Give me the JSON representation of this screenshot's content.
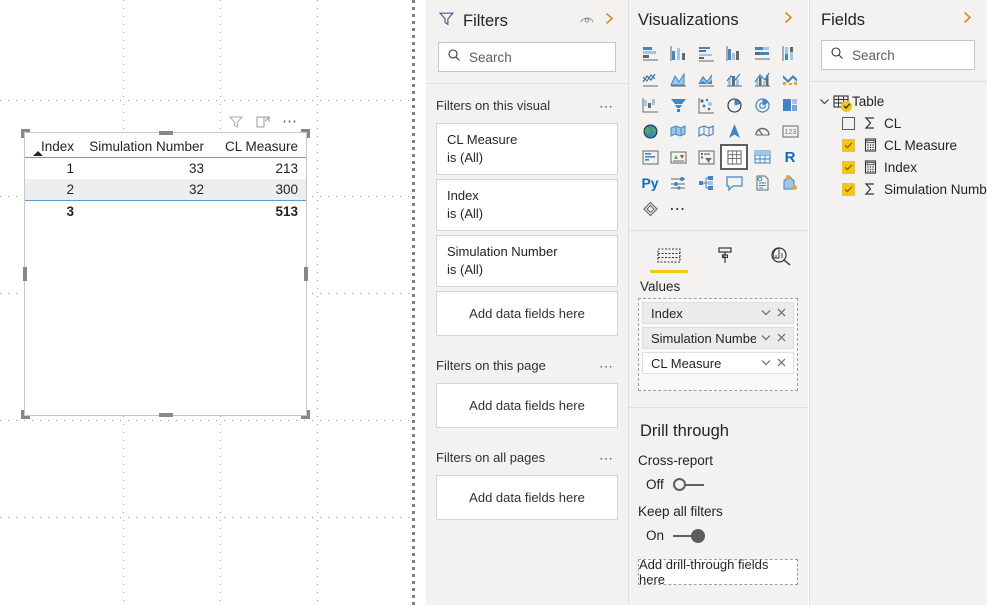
{
  "canvas": {
    "visual_header": {
      "filter_icon": "filter-funnel-icon",
      "focus_icon": "focus-mode-icon",
      "more_label": "⋯"
    },
    "table_visual": {
      "columns": [
        "Index",
        "Simulation Number",
        "CL Measure"
      ],
      "sort_column": "Index",
      "sort_direction": "ascending",
      "rows": [
        {
          "index": "1",
          "simulation_number": "33",
          "cl_measure": "213"
        },
        {
          "index": "2",
          "simulation_number": "32",
          "cl_measure": "300"
        }
      ],
      "total": {
        "index": "3",
        "simulation_number": "",
        "cl_measure": "513"
      }
    }
  },
  "filters": {
    "title": "Filters",
    "hide_icon": "eye-hide-icon",
    "expand_icon": "chevron-right-icon",
    "search": {
      "placeholder": "Search",
      "icon": "search-icon"
    },
    "groups": [
      {
        "label": "Filters on this visual",
        "menu": "⋯",
        "cards": [
          {
            "name": "CL Measure",
            "value": "is (All)"
          },
          {
            "name": "Index",
            "value": "is (All)"
          },
          {
            "name": "Simulation Number",
            "value": "is (All)"
          }
        ],
        "dropzone": "Add data fields here"
      },
      {
        "label": "Filters on this page",
        "menu": "⋯",
        "cards": [],
        "dropzone": "Add data fields here"
      },
      {
        "label": "Filters on all pages",
        "menu": "⋯",
        "cards": [],
        "dropzone": "Add data fields here"
      }
    ]
  },
  "visualizations": {
    "title": "Visualizations",
    "expand_icon": "chevron-right-icon",
    "gallery": [
      "stacked-bar-chart-icon",
      "stacked-column-chart-icon",
      "clustered-bar-chart-icon",
      "clustered-column-chart-icon",
      "hundred-percent-stacked-bar-chart-icon",
      "hundred-percent-stacked-column-chart-icon",
      "line-chart-icon",
      "area-chart-icon",
      "stacked-area-chart-icon",
      "line-stacked-column-chart-icon",
      "line-clustered-column-chart-icon",
      "ribbon-chart-icon",
      "waterfall-chart-icon",
      "funnel-chart-icon",
      "scatter-chart-icon",
      "pie-chart-icon",
      "donut-chart-icon",
      "treemap-icon",
      "map-icon",
      "filled-map-icon",
      "shape-map-icon",
      "arcgis-map-icon",
      "gauge-icon",
      "card-icon",
      "multi-row-card-icon",
      "kpi-icon",
      "slicer-icon",
      "table-icon",
      "matrix-icon",
      "r-script-visual-icon",
      "python-visual-icon",
      "key-influencers-icon",
      "decomposition-tree-icon",
      "qna-icon",
      "smart-narrative-icon",
      "paginated-report-icon",
      "power-apps-visual-icon"
    ],
    "selected_visual": "table-icon",
    "more_visuals_label": "⋯",
    "well_tabs": [
      {
        "name": "fields-tab",
        "icon": "fields-table-icon",
        "active": true
      },
      {
        "name": "format-tab",
        "icon": "paint-roller-icon",
        "active": false
      },
      {
        "name": "analytics-tab",
        "icon": "magnifier-analytics-icon",
        "active": false
      }
    ],
    "well_label": "Values",
    "well_chips": [
      "Index",
      "Simulation Number",
      "CL Measure"
    ],
    "chip_dropdown_icon": "chevron-down-icon",
    "chip_remove_icon": "close-x-icon",
    "drill_through": {
      "title": "Drill through",
      "cross_report_label": "Cross-report",
      "cross_report_state": "Off",
      "keep_all_filters_label": "Keep all filters",
      "keep_all_filters_state": "On",
      "dropzone": "Add drill-through fields here"
    }
  },
  "fields": {
    "title": "Fields",
    "expand_icon": "chevron-right-icon",
    "search": {
      "placeholder": "Search",
      "icon": "search-icon"
    },
    "table": {
      "label": "Table",
      "expanded": true,
      "chevron": "chevron-down-icon"
    },
    "items": [
      {
        "label": "CL",
        "checked": false,
        "icon": "sigma-icon"
      },
      {
        "label": "CL Measure",
        "checked": true,
        "icon": "calculator-measure-icon"
      },
      {
        "label": "Index",
        "checked": true,
        "icon": "calculator-measure-icon"
      },
      {
        "label": "Simulation Numb...",
        "checked": true,
        "icon": "sigma-icon"
      }
    ]
  },
  "theme": {
    "accent_yellow": "#F2C811",
    "pane_background": "#f3f2f1",
    "table_rule_blue": "#5b9bd5",
    "icon_blue": "#0f6cbd",
    "text_primary": "#252423"
  }
}
